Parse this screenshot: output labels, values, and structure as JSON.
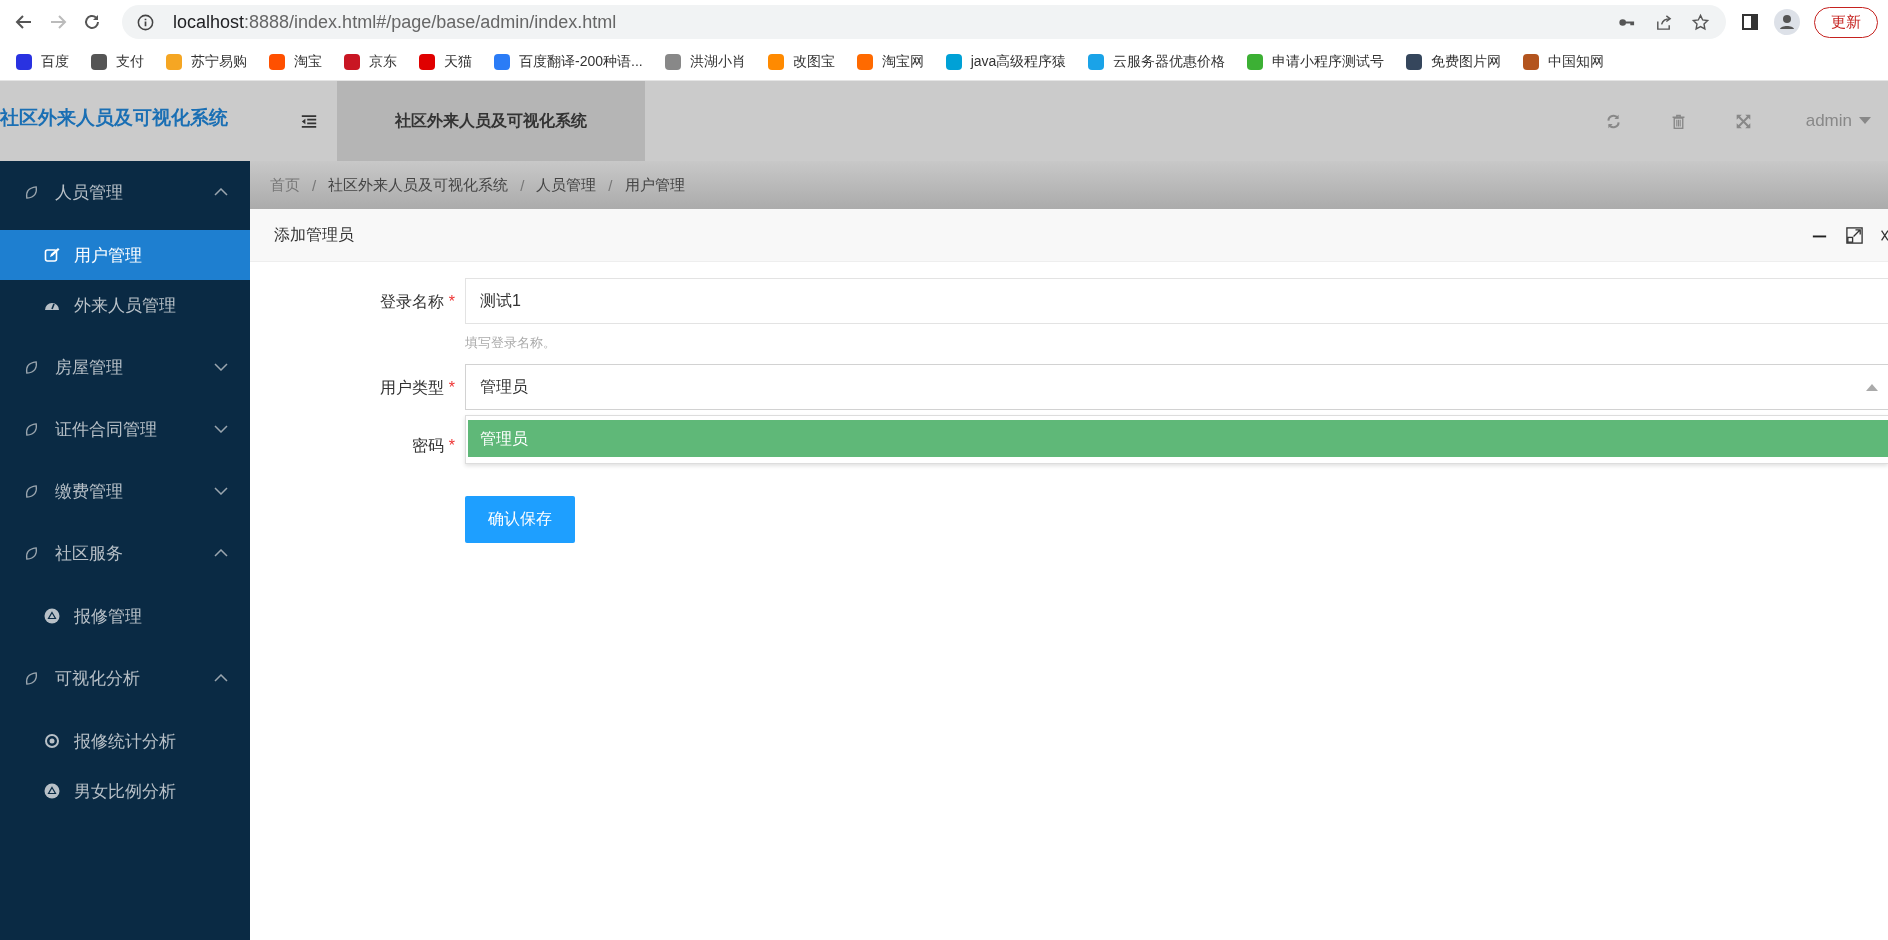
{
  "browser": {
    "url_host": "localhost",
    "url_rest": ":8888/index.html#/page/base/admin/index.html",
    "update_button": "更新",
    "bookmarks": [
      {
        "label": "百度",
        "color": "#2932e1"
      },
      {
        "label": "支付",
        "color": "#555555"
      },
      {
        "label": "苏宁易购",
        "color": "#f5a623"
      },
      {
        "label": "淘宝",
        "color": "#ff5000"
      },
      {
        "label": "京东",
        "color": "#c91623"
      },
      {
        "label": "天猫",
        "color": "#e00000"
      },
      {
        "label": "百度翻译-200种语...",
        "color": "#2b7cf6"
      },
      {
        "label": "洪湖小肖",
        "color": "#888888"
      },
      {
        "label": "改图宝",
        "color": "#ff8a00"
      },
      {
        "label": "淘宝网",
        "color": "#ff6a00"
      },
      {
        "label": "java高级程序猿",
        "color": "#00a1d6"
      },
      {
        "label": "云服务器优惠价格",
        "color": "#1aa3e8"
      },
      {
        "label": "申请小程序测试号",
        "color": "#3cb034"
      },
      {
        "label": "免费图片网",
        "color": "#35465c"
      },
      {
        "label": "中国知网",
        "color": "#b3541e"
      }
    ]
  },
  "header": {
    "logo": "社区外来人员及可视化系统",
    "tab": "社区外来人员及可视化系统",
    "user": "admin"
  },
  "sidebar": {
    "groups": [
      {
        "label": "人员管理",
        "expanded": true,
        "children": [
          {
            "label": "用户管理",
            "selected": true
          },
          {
            "label": "外来人员管理",
            "selected": false
          }
        ]
      },
      {
        "label": "房屋管理",
        "expanded": false
      },
      {
        "label": "证件合同管理",
        "expanded": false
      },
      {
        "label": "缴费管理",
        "expanded": false
      },
      {
        "label": "社区服务",
        "expanded": true,
        "children": [
          {
            "label": "报修管理",
            "selected": false
          }
        ]
      },
      {
        "label": "可视化分析",
        "expanded": true,
        "children": [
          {
            "label": "报修统计分析",
            "selected": false
          },
          {
            "label": "男女比例分析",
            "selected": false
          }
        ]
      }
    ]
  },
  "breadcrumb": {
    "separator": "/",
    "items": [
      "首页",
      "社区外来人员及可视化系统",
      "人员管理",
      "用户管理"
    ]
  },
  "dialog": {
    "title": "添加管理员",
    "login_name": {
      "label": "登录名称",
      "required_mark": "*",
      "value": "测试1",
      "hint": "填写登录名称。"
    },
    "user_type": {
      "label": "用户类型",
      "required_mark": "*",
      "value": "管理员",
      "expanded": true,
      "options": [
        {
          "label": "管理员",
          "selected": true
        }
      ]
    },
    "password": {
      "label": "密码",
      "required_mark": "*"
    },
    "save_button": "确认保存"
  }
}
